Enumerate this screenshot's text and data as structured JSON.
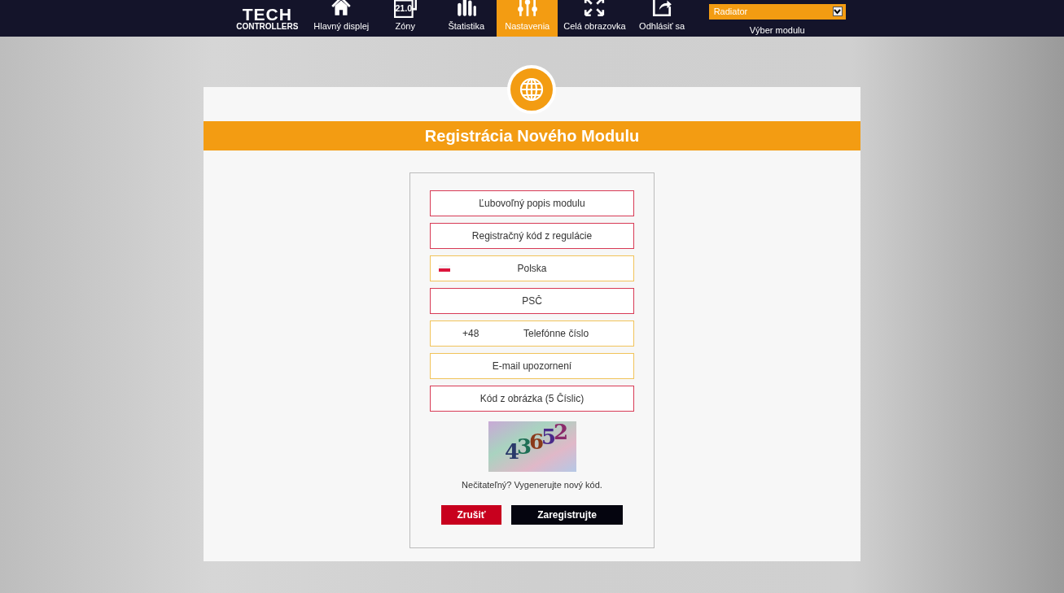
{
  "nav": {
    "logo": {
      "line1": "TECH",
      "line2": "CONTROLLERS"
    },
    "items": [
      {
        "label": "Hlavný displej",
        "selected": false
      },
      {
        "label": "Zóny",
        "selected": false
      },
      {
        "label": "Štatistika",
        "selected": false
      },
      {
        "label": "Nastavenia",
        "selected": true
      },
      {
        "label": "Celá obrazovka",
        "selected": false
      },
      {
        "label": "Odhlásiť sa",
        "selected": false
      }
    ],
    "zones_icon_text": "21.0",
    "module_select": {
      "value": "Radiator",
      "label": "Výber modulu"
    }
  },
  "panel": {
    "title": "Registrácia Nového Modulu",
    "fields": [
      {
        "kind": "text",
        "placeholder": "Ľubovoľný popis modulu",
        "required": true
      },
      {
        "kind": "text",
        "placeholder": "Registračný kód z regulácie",
        "required": true
      },
      {
        "kind": "country",
        "value": "Polska",
        "required": false
      },
      {
        "kind": "text",
        "placeholder": "PSČ",
        "required": true
      },
      {
        "kind": "phone",
        "prefix": "+48",
        "placeholder": "Telefónne číslo",
        "required": false
      },
      {
        "kind": "text",
        "placeholder": "E-mail upozornení",
        "required": false
      },
      {
        "kind": "text",
        "placeholder": "Kód z obrázka (5 Číslic)",
        "required": true
      }
    ],
    "captcha": {
      "code": "43652"
    },
    "regenerate_text": "Nečitateľný? Vygenerujte nový kód.",
    "buttons": [
      {
        "kind": "cancel",
        "label": "Zrušiť"
      },
      {
        "kind": "submit",
        "label": "Zaregistrujte"
      }
    ]
  }
}
